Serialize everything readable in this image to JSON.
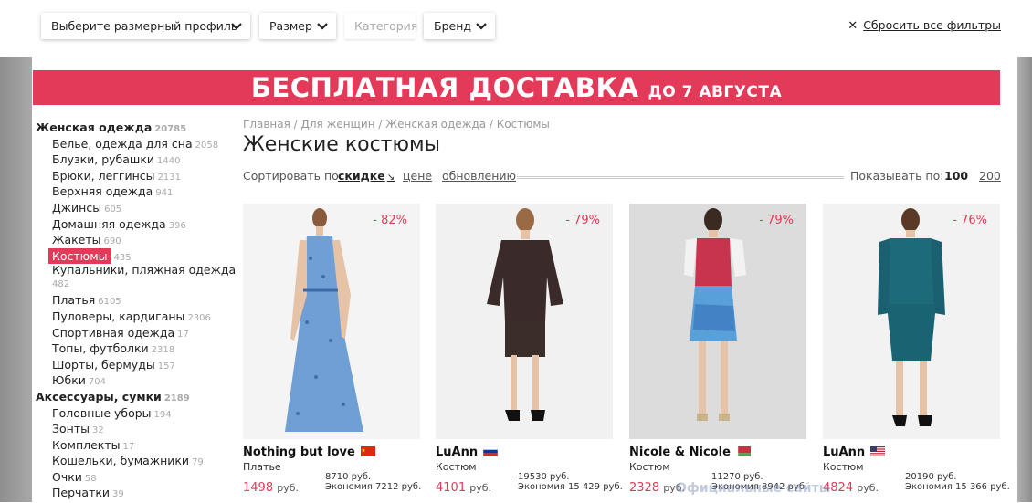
{
  "filters": {
    "profile_label": "Выберите размерный профиль",
    "size_label": "Размер",
    "category_label": "Категория",
    "brand_label": "Бренд",
    "reset_label": "Сбросить все фильтры",
    "chevron": "⌄"
  },
  "banner": {
    "main": "БЕСПЛАТНАЯ ДОСТАВКА",
    "sub": "ДО 7 АВГУСТА",
    "color": "#e23a58"
  },
  "sidebar": {
    "women": {
      "label": "Женская одежда",
      "count": "20785"
    },
    "women_items": [
      {
        "label": "Белье, одежда для сна",
        "count": "2058"
      },
      {
        "label": "Блузки, рубашки",
        "count": "1440"
      },
      {
        "label": "Брюки, леггинсы",
        "count": "2131"
      },
      {
        "label": "Верхняя одежда",
        "count": "941"
      },
      {
        "label": "Джинсы",
        "count": "605"
      },
      {
        "label": "Домашняя одежда",
        "count": "396"
      },
      {
        "label": "Жакеты",
        "count": "690"
      },
      {
        "label": "Костюмы",
        "count": "435"
      },
      {
        "label": "Купальники, пляжная одежда",
        "count": "482"
      },
      {
        "label": "Платья",
        "count": "6105"
      },
      {
        "label": "Пуловеры, кардиганы",
        "count": "2306"
      },
      {
        "label": "Спортивная одежда",
        "count": "17"
      },
      {
        "label": "Топы, футболки",
        "count": "2318"
      },
      {
        "label": "Шорты, бермуды",
        "count": "157"
      },
      {
        "label": "Юбки",
        "count": "704"
      }
    ],
    "accessories": {
      "label": "Аксессуары, сумки",
      "count": "2189"
    },
    "accessories_items": [
      {
        "label": "Головные уборы",
        "count": "194"
      },
      {
        "label": "Зонты",
        "count": "32"
      },
      {
        "label": "Комплекты",
        "count": "17"
      },
      {
        "label": "Кошельки, бумажники",
        "count": "79"
      },
      {
        "label": "Очки",
        "count": "58"
      },
      {
        "label": "Перчатки",
        "count": "39"
      }
    ]
  },
  "breadcrumb": "Главная / Для женщин / Женская одежда / Костюмы",
  "page_title": "Женские костюмы",
  "sort": {
    "label": "Сортировать по:",
    "discount": "скидке",
    "arrow": "↘",
    "price": "цене",
    "update": "обновлению",
    "show_label": "Показывать по:",
    "opt100": "100",
    "opt200": "200"
  },
  "products": [
    {
      "brand": "Nothing but love",
      "type": "Платье",
      "discount": "- 82%",
      "price": "1498",
      "old": "8710 руб.",
      "economy": "Экономия 7212 руб.",
      "flag": "china"
    },
    {
      "brand": "LuAnn",
      "type": "Костюм",
      "discount": "- 79%",
      "price": "4101",
      "old": "19530 руб.",
      "economy": "Экономия 15 429 руб.",
      "flag": "russia"
    },
    {
      "brand": "Nicole & Nicole",
      "type": "Костюм",
      "discount": "- 79%",
      "price": "2328",
      "old": "11270 руб.",
      "economy": "Экономия 8942 руб.",
      "flag": "belarus"
    },
    {
      "brand": "LuAnn",
      "type": "Костюм",
      "discount": "- 76%",
      "price": "4824",
      "old": "20190 руб.",
      "economy": "Экономия 15 366 руб.",
      "flag": "usa"
    }
  ],
  "currency": "руб.",
  "watermark": "Официальные сайты",
  "icons": {
    "close": "close-icon",
    "chevron": "chevron-down-icon",
    "sort_arrow": "sort-arrow-icon"
  }
}
